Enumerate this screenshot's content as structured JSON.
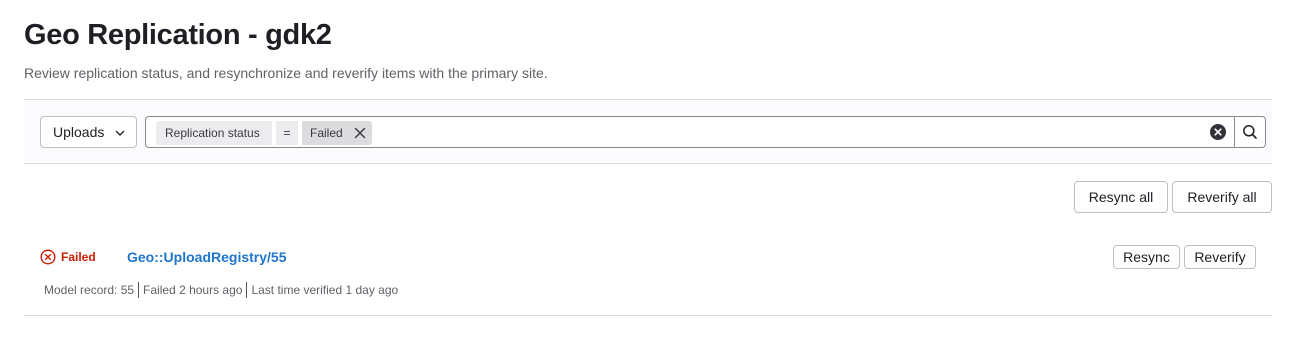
{
  "header": {
    "title": "Geo Replication - gdk2",
    "description": "Review replication status, and resynchronize and reverify items with the primary site."
  },
  "filter_bar": {
    "type_dropdown": {
      "selected": "Uploads"
    },
    "token": {
      "name": "Replication status",
      "operator": "=",
      "value": "Failed"
    },
    "search": {
      "value": "",
      "placeholder": ""
    }
  },
  "bulk_actions": {
    "resync_all_label": "Resync all",
    "reverify_all_label": "Reverify all"
  },
  "items": [
    {
      "status": "Failed",
      "status_color": "#c91c00",
      "name": "Geo::UploadRegistry/55",
      "model_record": "Model record: 55",
      "failed_time": "Failed 2 hours ago",
      "verified_time": "Last time verified 1 day ago",
      "resync_label": "Resync",
      "reverify_label": "Reverify"
    }
  ],
  "colors": {
    "link": "#1f75cb",
    "failed": "#c91c00",
    "border": "#dcdcde"
  },
  "icons": [
    "chevron-down-icon",
    "close-icon",
    "clear-icon",
    "search-icon",
    "status-failed-icon"
  ]
}
